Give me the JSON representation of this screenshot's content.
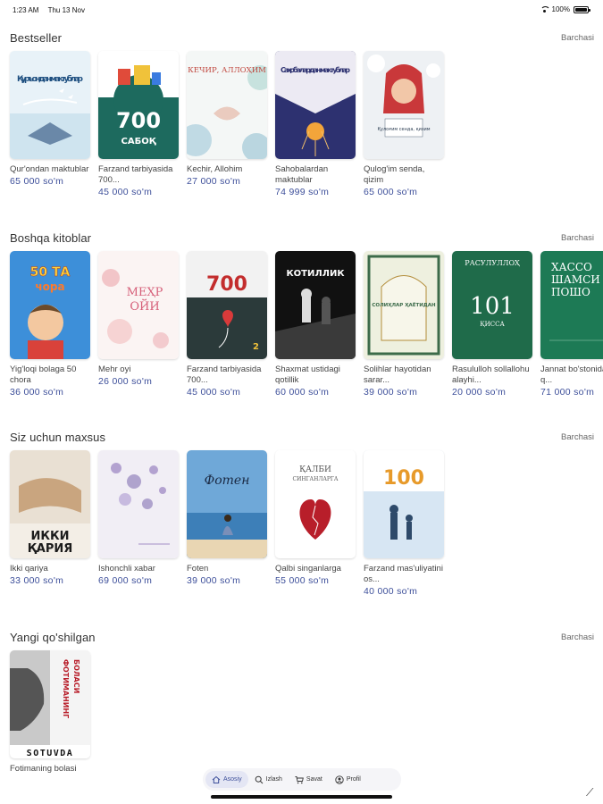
{
  "status_bar": {
    "time": "1:23 AM",
    "date": "Thu 13 Nov",
    "battery": "100%",
    "battery_level": 1.0
  },
  "sections": [
    {
      "title": "Bestseller",
      "see_all": "Barchasi",
      "books": [
        {
          "title": "Qur'ondan maktublar",
          "price": "65 000 so'm",
          "cover": "cover-quron"
        },
        {
          "title": "Farzand tarbiyasida 700...",
          "price": "45 000 so'm",
          "cover": "cover-700-sabok"
        },
        {
          "title": "Kechir, Allohim",
          "price": "27 000 so'm",
          "cover": "cover-kechir"
        },
        {
          "title": "Sahobalardan maktublar",
          "price": "74 999 so'm",
          "cover": "cover-sahobalar"
        },
        {
          "title": "Qulog'im senda, qizim",
          "price": "65 000 so'm",
          "cover": "cover-qulogim"
        }
      ]
    },
    {
      "title": "Boshqa kitoblar",
      "see_all": "Barchasi",
      "books": [
        {
          "title": "Yig'loqi bolaga 50 chora",
          "price": "36 000 so'm",
          "cover": "cover-50-chora"
        },
        {
          "title": "Mehr oyi",
          "price": "26 000 so'm",
          "cover": "cover-mehr"
        },
        {
          "title": "Farzand tarbiyasida 700...",
          "price": "45 000 so'm",
          "cover": "cover-700-2"
        },
        {
          "title": "Shaxmat ustidagi qotillik",
          "price": "60 000 so'm",
          "cover": "cover-shaxmat"
        },
        {
          "title": "Solihlar hayotidan sarar...",
          "price": "39 000 so'm",
          "cover": "cover-solihlar"
        },
        {
          "title": "Rasululloh sollallohu alayhi...",
          "price": "20 000 so'm",
          "cover": "cover-101"
        },
        {
          "title": "Jannat bo'stonidagi q...",
          "price": "71 000 so'm",
          "cover": "cover-xassos"
        }
      ]
    },
    {
      "title": "Siz uchun maxsus",
      "see_all": "Barchasi",
      "books": [
        {
          "title": "Ikki qariya",
          "price": "33 000 so'm",
          "cover": "cover-ikki"
        },
        {
          "title": "Ishonchli xabar",
          "price": "69 000 so'm",
          "cover": "cover-ishonchli"
        },
        {
          "title": "Foten",
          "price": "39 000 so'm",
          "cover": "cover-foten"
        },
        {
          "title": "Qalbi singanlarga",
          "price": "55 000 so'm",
          "cover": "cover-qalbi"
        },
        {
          "title": "Farzand mas'uliyatini os...",
          "price": "40 000 so'm",
          "cover": "cover-100"
        }
      ]
    },
    {
      "title": "Yangi qo'shilgan",
      "see_all": "Barchasi",
      "books": [
        {
          "title": "Fotimaning bolasi",
          "price": "",
          "cover": "cover-fotima"
        }
      ]
    }
  ],
  "cover_text": {
    "quron": "Қуръондан мактублар",
    "sabok_700": "700",
    "sabok_word": "САБОҚ",
    "kechir": "КЕЧИР, АЛЛОҲИМ",
    "sahobalar": "Саҳобалардан мактублар",
    "qulogim": "Қулоғим сенда, қизим",
    "chora_50": "50 ТА",
    "chora_word": "чора",
    "mehr_1": "МЕҲР",
    "mehr_2": "ОЙИ",
    "shaxmat": "КОТИЛЛИК",
    "solihlar": "СОЛИҲЛАР ҲАЁТИДАН",
    "rasululloh": "РАСУЛУЛЛОҲ",
    "n101": "101",
    "qissa": "ҚИССА",
    "xassos_1": "ХАССО",
    "xassos_2": "ШАМСИ",
    "xassos_3": "ПОШО",
    "ikki_1": "ИККИ",
    "ikki_2": "ҚАРИЯ",
    "foten": "Фотен",
    "qalbi_1": "ҚАЛБИ",
    "qalbi_2": "СИНГАНЛАРГА",
    "n100": "100",
    "fotima_1": "ФОТИМАНИНГ",
    "fotima_2": "БОЛАСИ",
    "sotuvda": "SOTUVDA"
  },
  "nav": {
    "items": [
      {
        "label": "Asosiy",
        "icon": "home-icon",
        "active": true
      },
      {
        "label": "Izlash",
        "icon": "search-icon",
        "active": false
      },
      {
        "label": "Savat",
        "icon": "cart-icon",
        "active": false
      },
      {
        "label": "Profil",
        "icon": "profile-icon",
        "active": false
      }
    ]
  },
  "colors": {
    "accent": "#3d4f9a",
    "price": "#3d4f9a",
    "nav_active_bg": "#e4e6f4"
  }
}
